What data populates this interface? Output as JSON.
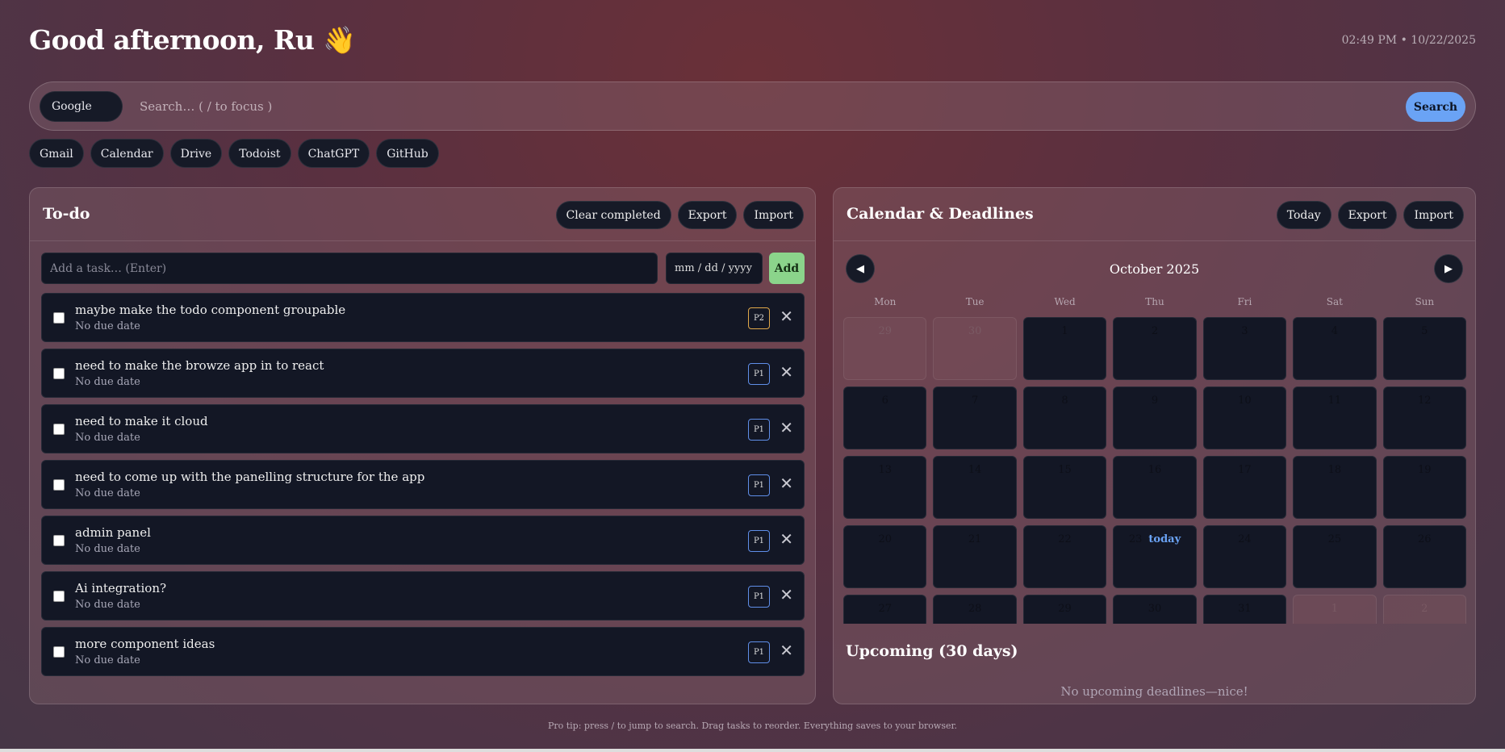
{
  "header": {
    "greeting": "Good afternoon, Ru 👋",
    "clock": "02:49 PM • 10/22/2025"
  },
  "search": {
    "engine": "Google",
    "placeholder": "Search… ( / to focus )",
    "button": "Search"
  },
  "quick_links": [
    "Gmail",
    "Calendar",
    "Drive",
    "Todoist",
    "ChatGPT",
    "GitHub"
  ],
  "todo": {
    "title": "To-do",
    "actions": {
      "clear": "Clear completed",
      "export": "Export",
      "import": "Import"
    },
    "add_placeholder": "Add a task… (Enter)",
    "date_placeholder": "mm / dd / yyyy",
    "add_button": "Add",
    "tasks": [
      {
        "title": "maybe make the todo component groupable",
        "due": "No due date",
        "priority": "P2"
      },
      {
        "title": "need to make the browze app in to react",
        "due": "No due date",
        "priority": "P1"
      },
      {
        "title": "need to make it cloud",
        "due": "No due date",
        "priority": "P1"
      },
      {
        "title": "need to come up with the panelling structure for the app",
        "due": "No due date",
        "priority": "P1"
      },
      {
        "title": "admin panel",
        "due": "No due date",
        "priority": "P1"
      },
      {
        "title": "Ai integration?",
        "due": "No due date",
        "priority": "P1"
      },
      {
        "title": "more component ideas",
        "due": "No due date",
        "priority": "P1"
      }
    ]
  },
  "calendar": {
    "title": "Calendar & Deadlines",
    "actions": {
      "today": "Today",
      "export": "Export",
      "import": "Import"
    },
    "prev": "◀",
    "next": "▶",
    "month": "October 2025",
    "weekdays": [
      "Mon",
      "Tue",
      "Wed",
      "Thu",
      "Fri",
      "Sat",
      "Sun"
    ],
    "today_label": "today",
    "days": [
      {
        "d": "29",
        "muted": true
      },
      {
        "d": "30",
        "muted": true
      },
      {
        "d": "1"
      },
      {
        "d": "2"
      },
      {
        "d": "3"
      },
      {
        "d": "4"
      },
      {
        "d": "5"
      },
      {
        "d": "6"
      },
      {
        "d": "7"
      },
      {
        "d": "8"
      },
      {
        "d": "9"
      },
      {
        "d": "10"
      },
      {
        "d": "11"
      },
      {
        "d": "12"
      },
      {
        "d": "13"
      },
      {
        "d": "14"
      },
      {
        "d": "15"
      },
      {
        "d": "16"
      },
      {
        "d": "17"
      },
      {
        "d": "18"
      },
      {
        "d": "19"
      },
      {
        "d": "20"
      },
      {
        "d": "21"
      },
      {
        "d": "22"
      },
      {
        "d": "23",
        "today": true
      },
      {
        "d": "24"
      },
      {
        "d": "25"
      },
      {
        "d": "26"
      },
      {
        "d": "27"
      },
      {
        "d": "28"
      },
      {
        "d": "29"
      },
      {
        "d": "30"
      },
      {
        "d": "31"
      },
      {
        "d": "1",
        "muted": true
      },
      {
        "d": "2",
        "muted": true
      }
    ],
    "upcoming_title": "Upcoming (30 days)",
    "upcoming_empty": "No upcoming deadlines—nice!"
  },
  "footer": {
    "tip": "Pro tip: press / to jump to search. Drag tasks to reorder. Everything saves to your browser."
  },
  "colors": {
    "accent": "#6aa3f5",
    "add_button": "#8bd48b",
    "p1": "#5f8ee8",
    "p2": "#e0a84a"
  }
}
